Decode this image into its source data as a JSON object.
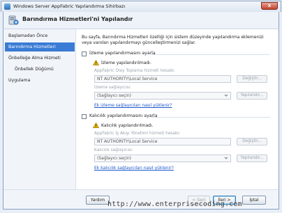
{
  "window": {
    "title": "Windows Server AppFabric Yapılandırma Sihirbazı",
    "close_glyph": "x"
  },
  "banner": {
    "title": "Barındırma Hizmetleri'ni Yapılandır"
  },
  "sidebar": {
    "items": [
      {
        "label": "Başlamadan Önce",
        "active": false,
        "sub": false
      },
      {
        "label": "Barındırma Hizmetleri",
        "active": true,
        "sub": false
      },
      {
        "label": "Önbelleğe Alma Hizmeti",
        "active": false,
        "sub": false
      },
      {
        "label": "Önbellek Düğümü",
        "active": false,
        "sub": true
      },
      {
        "label": "Uygulama",
        "active": false,
        "sub": false
      }
    ]
  },
  "main": {
    "description": "Bu sayfa, Barındırma Hizmetleri özelliği için sistem düzeyinde yapılandırma eklemenizi veya varolan yapılandırmayı güncelleştirmenizi sağlar.",
    "monitoring": {
      "checkbox_label": "İzleme yapılandırmasını ayarla",
      "warning": "İzleme yapılandırılmadı.",
      "account_label": "AppFabric Olay Toplama hizmeti hesabı:",
      "account_value": "NT AUTHORITY\\Local Service",
      "change_button": "Değiştir...",
      "provider_label": "İzleme sağlayıcısı:",
      "provider_value": "(Sağlayıcı seçin)",
      "configure_button": "Yapılandır...",
      "link": "Ek izleme sağlayıcıları nasıl yüklenir?"
    },
    "persistence": {
      "checkbox_label": "Kalıcılık yapılandırmasını ayarla",
      "warning": "Kalıcılık yapılandırılmadı.",
      "account_label": "AppFabric İş Akışı Yönetimi hizmeti hesabı:",
      "account_value": "NT AUTHORITY\\Local Service",
      "change_button": "Değiştir...",
      "provider_label": "Kalıcılık sağlayıcısı:",
      "provider_value": "(Sağlayıcı seçin)",
      "configure_button": "Yapılandır...",
      "link": "Ek kalıcılık sağlayıcıları nasıl yüklenir?"
    }
  },
  "footer": {
    "help": "Yardım",
    "back": "< Geri",
    "next": "İleri >",
    "cancel": "İptal"
  },
  "watermark": "http://www.enterprisecoding.com",
  "colors": {
    "accent": "#3a7bd5",
    "link": "#1a55c9",
    "warning": "#f2c200"
  }
}
